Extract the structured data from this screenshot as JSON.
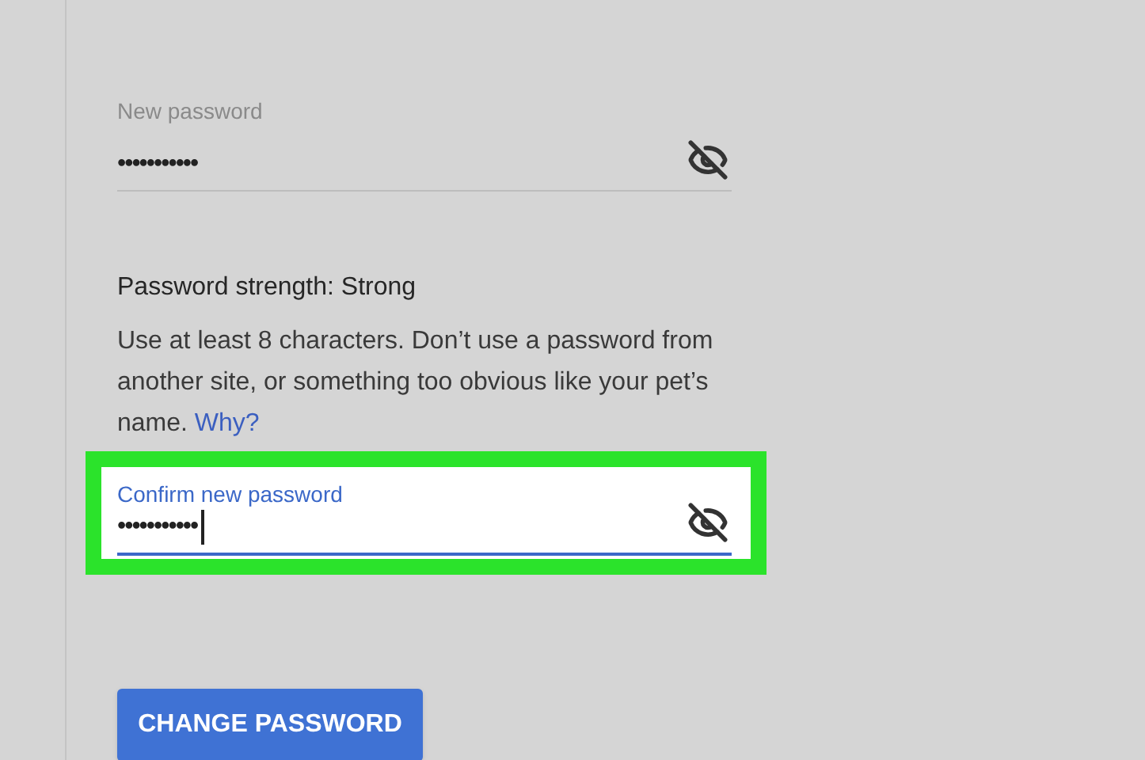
{
  "new_password": {
    "label": "New password",
    "value": "•••••••••••",
    "focused": false
  },
  "strength": {
    "label": "Password strength: Strong"
  },
  "hint": {
    "text": "Use at least 8 characters. Don’t use a password from another site, or something too obvious like your pet’s name.",
    "link": "Why?"
  },
  "confirm_password": {
    "label": "Confirm new password",
    "value": "•••••••••••",
    "focused": true,
    "highlighted": true
  },
  "button": {
    "label": "CHANGE PASSWORD"
  }
}
